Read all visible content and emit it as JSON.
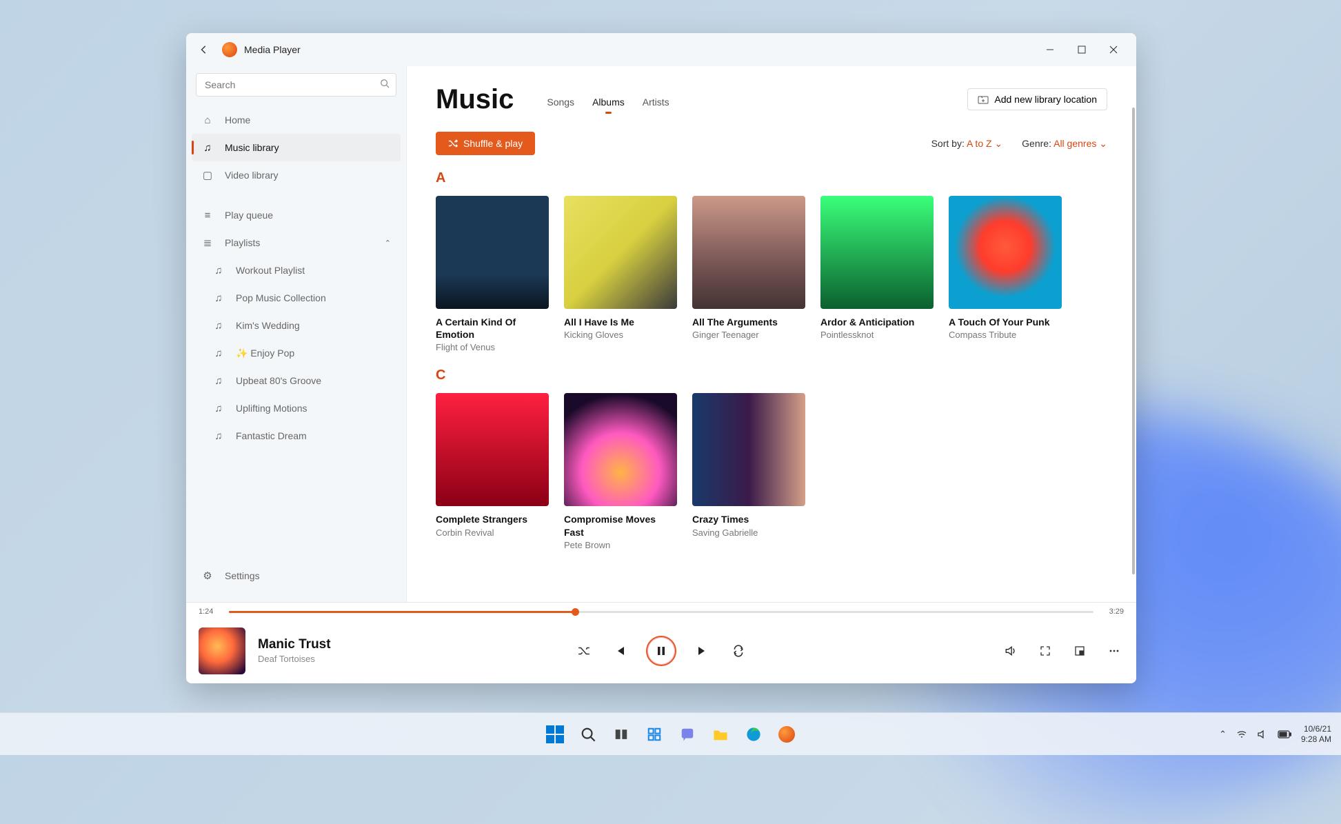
{
  "app": {
    "title": "Media Player"
  },
  "search": {
    "placeholder": "Search"
  },
  "sidebar": {
    "items": [
      {
        "icon": "home",
        "label": "Home"
      },
      {
        "icon": "music",
        "label": "Music library",
        "active": true
      },
      {
        "icon": "video",
        "label": "Video library"
      }
    ],
    "queue": {
      "label": "Play queue"
    },
    "playlists": {
      "label": "Playlists",
      "items": [
        {
          "label": "Workout Playlist"
        },
        {
          "label": "Pop Music Collection"
        },
        {
          "label": "Kim's Wedding"
        },
        {
          "label": "✨ Enjoy Pop"
        },
        {
          "label": "Upbeat 80's Groove"
        },
        {
          "label": "Uplifting Motions"
        },
        {
          "label": "Fantastic Dream"
        }
      ]
    },
    "settings": {
      "label": "Settings"
    }
  },
  "main": {
    "title": "Music",
    "tabs": [
      {
        "label": "Songs"
      },
      {
        "label": "Albums",
        "active": true
      },
      {
        "label": "Artists"
      }
    ],
    "add_library": "Add new library location",
    "shuffle": "Shuffle & play",
    "sort": {
      "label": "Sort by:",
      "value": "A to Z"
    },
    "genre": {
      "label": "Genre:",
      "value": "All genres"
    },
    "sections": [
      {
        "letter": "A",
        "albums": [
          {
            "title": "A Certain Kind Of Emotion",
            "artist": "Flight of Venus",
            "art": "art-a1"
          },
          {
            "title": "All I Have Is Me",
            "artist": "Kicking Gloves",
            "art": "art-a2"
          },
          {
            "title": "All The Arguments",
            "artist": "Ginger Teenager",
            "art": "art-a3"
          },
          {
            "title": "Ardor & Anticipation",
            "artist": "Pointlessknot",
            "art": "art-a4"
          },
          {
            "title": "A Touch Of Your Punk",
            "artist": "Compass Tribute",
            "art": "art-a5"
          }
        ]
      },
      {
        "letter": "C",
        "albums": [
          {
            "title": "Complete Strangers",
            "artist": "Corbin Revival",
            "art": "art-c1"
          },
          {
            "title": "Compromise Moves Fast",
            "artist": "Pete Brown",
            "art": "art-c2"
          },
          {
            "title": "Crazy Times",
            "artist": "Saving Gabrielle",
            "art": "art-c3"
          }
        ]
      }
    ]
  },
  "player": {
    "elapsed": "1:24",
    "total": "3:29",
    "progress_pct": 40,
    "now": {
      "title": "Manic Trust",
      "artist": "Deaf Tortoises"
    }
  },
  "taskbar": {
    "date": "10/6/21",
    "time": "9:28 AM"
  }
}
